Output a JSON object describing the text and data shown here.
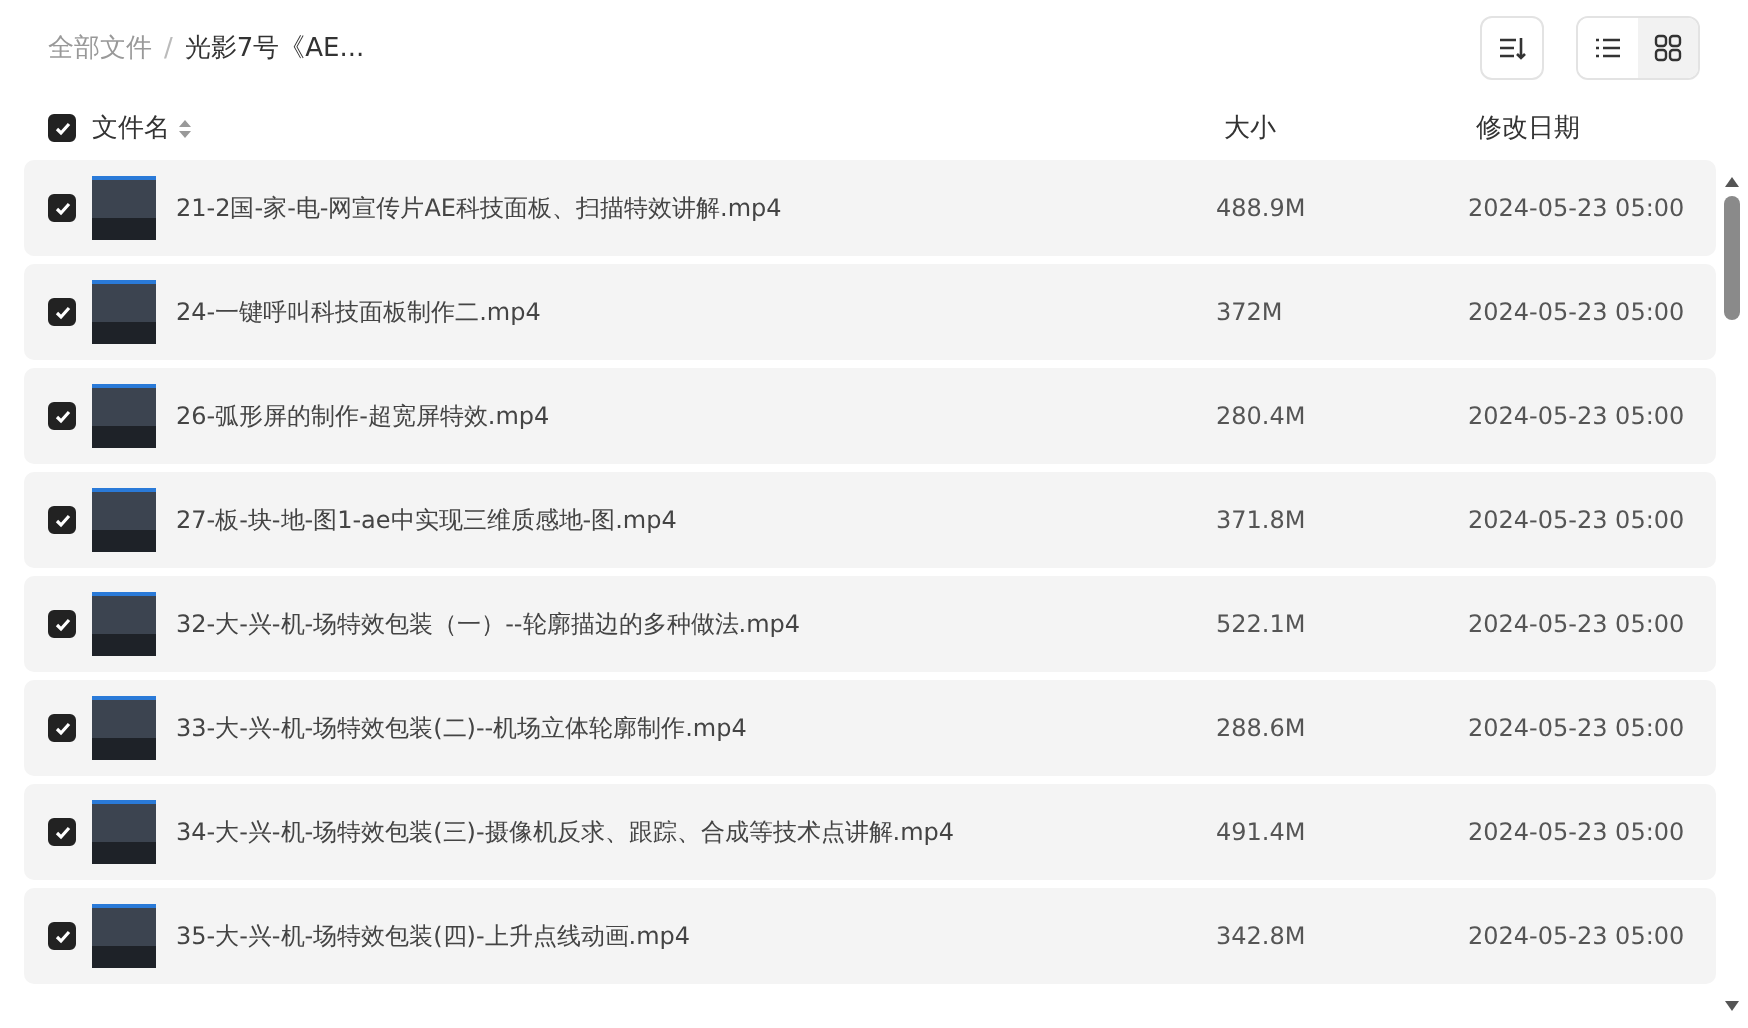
{
  "breadcrumb_separator": "/",
  "breadcrumb": [
    {
      "label": "全部文件",
      "current": false
    },
    {
      "label": "光影7号《AE...",
      "current": true
    }
  ],
  "view_modes": [
    {
      "kind": "list",
      "selected": false
    },
    {
      "kind": "grid",
      "selected": true
    }
  ],
  "table": {
    "all_selected": true,
    "columns": [
      "文件名",
      "大小",
      "修改日期"
    ],
    "rows": [
      {
        "name": "21-2国-家-电-网宣传片AE科技面板、扫描特效讲解.mp4",
        "size": "488.9M",
        "date": "2024-05-23 05:00",
        "selected": true
      },
      {
        "name": "24-一键呼叫科技面板制作二.mp4",
        "size": "372M",
        "date": "2024-05-23 05:00",
        "selected": true
      },
      {
        "name": "26-弧形屏的制作-超宽屏特效.mp4",
        "size": "280.4M",
        "date": "2024-05-23 05:00",
        "selected": true
      },
      {
        "name": "27-板-块-地-图1-ae中实现三维质感地-图.mp4",
        "size": "371.8M",
        "date": "2024-05-23 05:00",
        "selected": true
      },
      {
        "name": "32-大-兴-机-场特效包装（一）--轮廓描边的多种做法.mp4",
        "size": "522.1M",
        "date": "2024-05-23 05:00",
        "selected": true
      },
      {
        "name": "33-大-兴-机-场特效包装(二)--机场立体轮廓制作.mp4",
        "size": "288.6M",
        "date": "2024-05-23 05:00",
        "selected": true
      },
      {
        "name": "34-大-兴-机-场特效包装(三)-摄像机反求、跟踪、合成等技术点讲解.mp4",
        "size": "491.4M",
        "date": "2024-05-23 05:00",
        "selected": true
      },
      {
        "name": "35-大-兴-机-场特效包装(四)-上升点线动画.mp4",
        "size": "342.8M",
        "date": "2024-05-23 05:00",
        "selected": true
      }
    ]
  }
}
